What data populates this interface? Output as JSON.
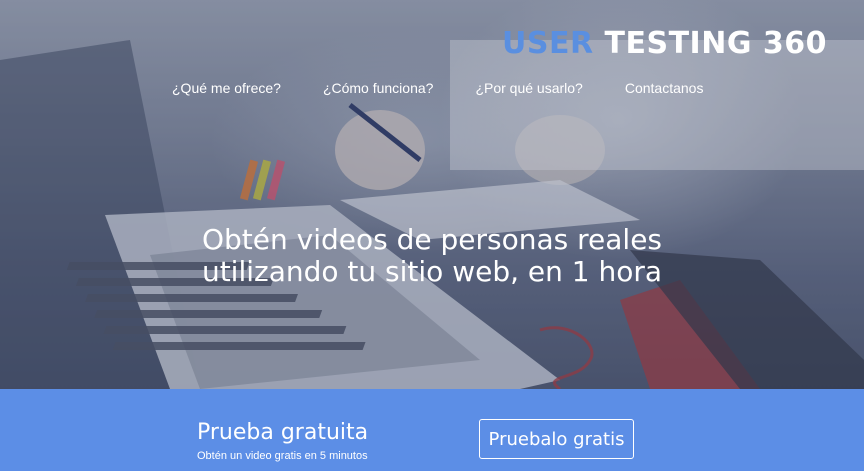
{
  "header": {
    "logo_part1": "USER",
    "logo_part2": "TESTING 360"
  },
  "nav": {
    "items": [
      {
        "label": "¿Qué me ofrece?"
      },
      {
        "label": "¿Cómo funciona?"
      },
      {
        "label": "¿Por qué usarlo?"
      },
      {
        "label": "Contactanos"
      }
    ]
  },
  "hero": {
    "headline_line1": "Obtén videos de personas reales",
    "headline_line2": "utilizando tu sitio web, en 1 hora"
  },
  "cta": {
    "title": "Prueba gratuita",
    "subtitle": "Obtén un video gratis en 5 minutos",
    "button_label": "Pruebalo gratis"
  },
  "colors": {
    "accent": "#5c8ee6",
    "logo_blue": "#5a8fe0"
  }
}
